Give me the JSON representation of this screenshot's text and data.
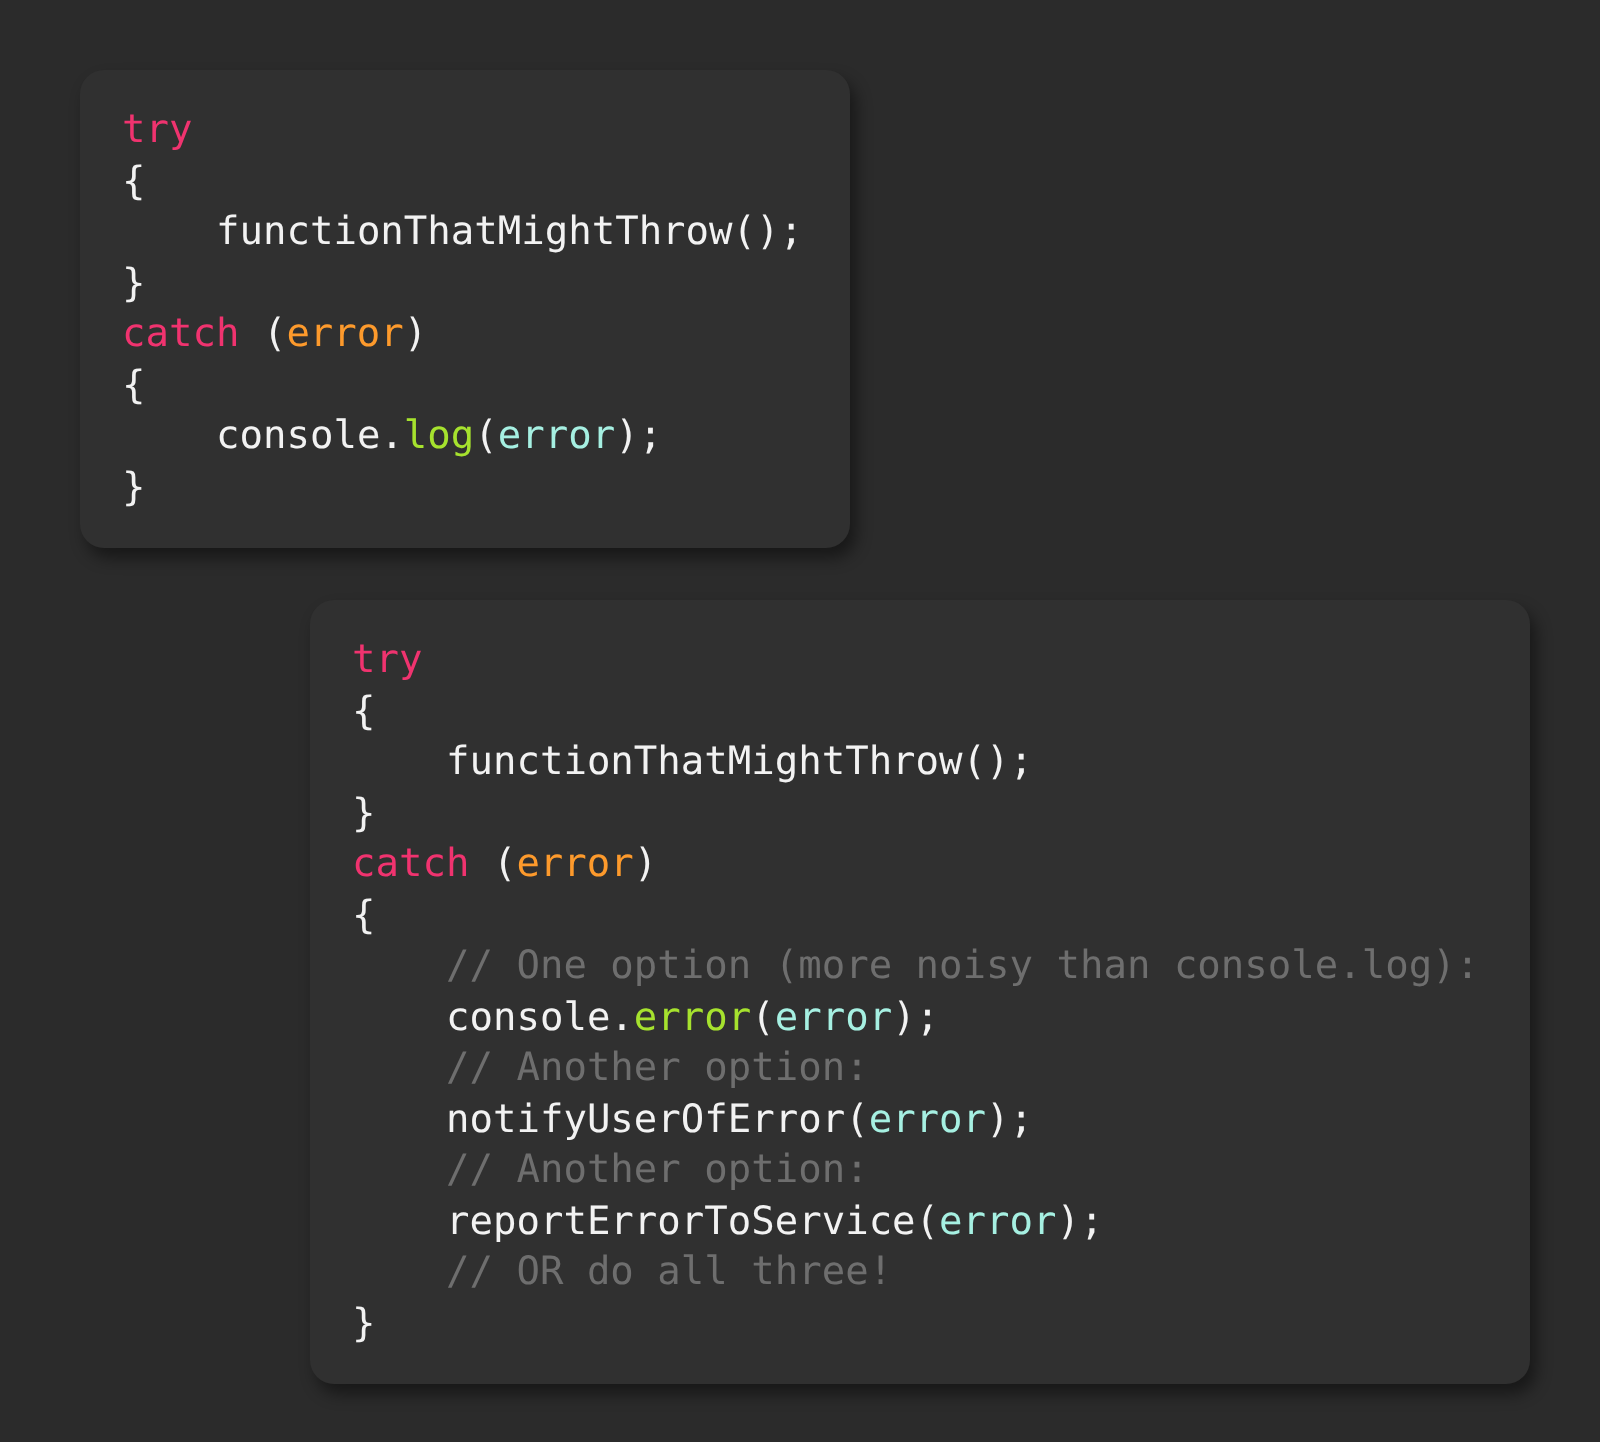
{
  "snippets": [
    {
      "lines": [
        {
          "tokens": [
            {
              "text": "try",
              "kind": "keyword"
            }
          ]
        },
        {
          "tokens": [
            {
              "text": "{",
              "kind": "plain"
            }
          ],
          "children": [
            {
              "tokens": [
                {
                  "text": "functionThatMightThrow();",
                  "kind": "plain"
                }
              ]
            }
          ]
        },
        {
          "tokens": [
            {
              "text": "}",
              "kind": "plain"
            }
          ]
        },
        {
          "tokens": [
            {
              "text": "catch",
              "kind": "keyword"
            },
            {
              "text": " (",
              "kind": "plain"
            },
            {
              "text": "error",
              "kind": "param"
            },
            {
              "text": ")",
              "kind": "plain"
            }
          ]
        },
        {
          "tokens": [
            {
              "text": "{",
              "kind": "plain"
            }
          ],
          "children": [
            {
              "tokens": [
                {
                  "text": "console.",
                  "kind": "plain"
                },
                {
                  "text": "log",
                  "kind": "method"
                },
                {
                  "text": "(",
                  "kind": "plain"
                },
                {
                  "text": "error",
                  "kind": "arg"
                },
                {
                  "text": ");",
                  "kind": "plain"
                }
              ]
            }
          ]
        },
        {
          "tokens": [
            {
              "text": "}",
              "kind": "plain"
            }
          ]
        }
      ]
    },
    {
      "lines": [
        {
          "tokens": [
            {
              "text": "try",
              "kind": "keyword"
            }
          ]
        },
        {
          "tokens": [
            {
              "text": "{",
              "kind": "plain"
            }
          ],
          "children": [
            {
              "tokens": [
                {
                  "text": "functionThatMightThrow();",
                  "kind": "plain"
                }
              ]
            }
          ]
        },
        {
          "tokens": [
            {
              "text": "}",
              "kind": "plain"
            }
          ]
        },
        {
          "tokens": [
            {
              "text": "catch",
              "kind": "keyword"
            },
            {
              "text": " (",
              "kind": "plain"
            },
            {
              "text": "error",
              "kind": "param"
            },
            {
              "text": ")",
              "kind": "plain"
            }
          ]
        },
        {
          "tokens": [
            {
              "text": "{",
              "kind": "plain"
            }
          ],
          "children": [
            {
              "tokens": [
                {
                  "text": "// One option (more noisy than console.log):",
                  "kind": "comment"
                }
              ]
            },
            {
              "tokens": [
                {
                  "text": "console.",
                  "kind": "plain"
                },
                {
                  "text": "error",
                  "kind": "method"
                },
                {
                  "text": "(",
                  "kind": "plain"
                },
                {
                  "text": "error",
                  "kind": "arg"
                },
                {
                  "text": ");",
                  "kind": "plain"
                }
              ]
            },
            {
              "tokens": [
                {
                  "text": "// Another option:",
                  "kind": "comment"
                }
              ]
            },
            {
              "tokens": [
                {
                  "text": "notifyUserOfError(",
                  "kind": "plain"
                },
                {
                  "text": "error",
                  "kind": "arg"
                },
                {
                  "text": ");",
                  "kind": "plain"
                }
              ]
            },
            {
              "tokens": [
                {
                  "text": "// Another option:",
                  "kind": "comment"
                }
              ]
            },
            {
              "tokens": [
                {
                  "text": "reportErrorToService(",
                  "kind": "plain"
                },
                {
                  "text": "error",
                  "kind": "arg"
                },
                {
                  "text": ");",
                  "kind": "plain"
                }
              ]
            },
            {
              "tokens": [
                {
                  "text": "// OR do all three!",
                  "kind": "comment"
                }
              ]
            }
          ]
        },
        {
          "tokens": [
            {
              "text": "}",
              "kind": "plain"
            }
          ]
        }
      ]
    }
  ]
}
